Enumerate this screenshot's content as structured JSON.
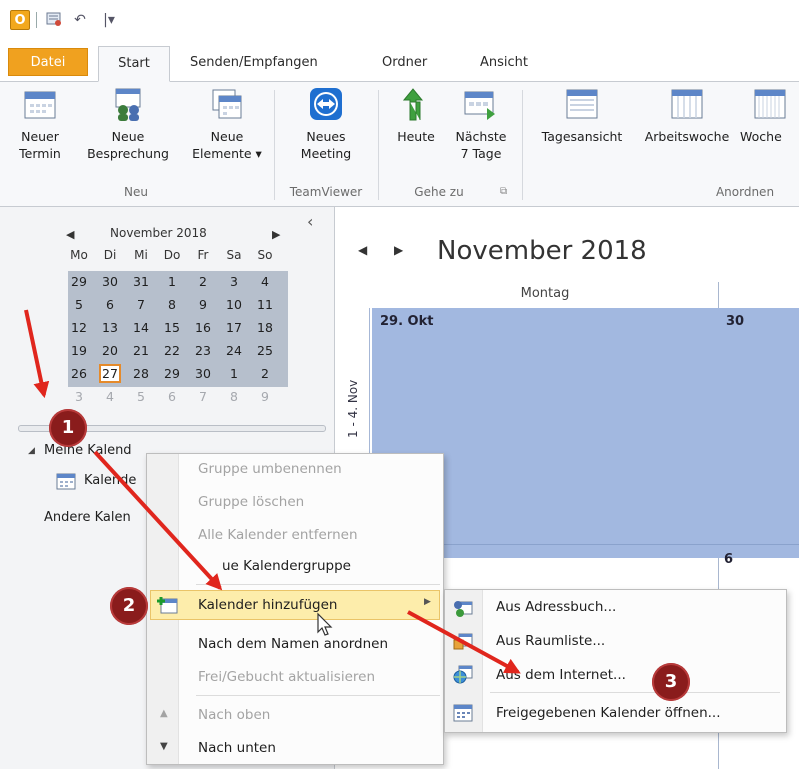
{
  "qat": {
    "undo_glyph": "↶",
    "dropdown_glyph": "|▾"
  },
  "tabs": {
    "file": "Datei",
    "start": "Start",
    "send_receive": "Senden/Empfangen",
    "folder": "Ordner",
    "view": "Ansicht"
  },
  "ribbon": {
    "new_appointment": [
      "Neuer",
      "Termin"
    ],
    "new_meeting": [
      "Neue",
      "Besprechung"
    ],
    "new_items": [
      "Neue",
      "Elemente ▾"
    ],
    "group_new": "Neu",
    "teamviewer_meeting": [
      "Neues",
      "Meeting"
    ],
    "group_teamviewer": "TeamViewer",
    "today": "Heute",
    "next7": [
      "Nächste",
      "7 Tage"
    ],
    "group_goto": "Gehe zu",
    "day_view": "Tagesansicht",
    "work_week": "Arbeitswoche",
    "week": "Woche",
    "group_arrange": "Anordnen"
  },
  "mini_calendar": {
    "month_label": "November 2018",
    "weekdays": [
      "Mo",
      "Di",
      "Mi",
      "Do",
      "Fr",
      "Sa",
      "So"
    ],
    "rows": [
      [
        "29",
        "30",
        "31",
        "1",
        "2",
        "3",
        "4"
      ],
      [
        "5",
        "6",
        "7",
        "8",
        "9",
        "10",
        "11"
      ],
      [
        "12",
        "13",
        "14",
        "15",
        "16",
        "17",
        "18"
      ],
      [
        "19",
        "20",
        "21",
        "22",
        "23",
        "24",
        "25"
      ],
      [
        "26",
        "27",
        "28",
        "29",
        "30",
        "1",
        "2"
      ],
      [
        "3",
        "4",
        "5",
        "6",
        "7",
        "8",
        "9"
      ]
    ],
    "today": "27"
  },
  "nav": {
    "collapse_glyph": "‹",
    "my_calendars": "Meine Kalend",
    "calendar_item": "Kalende",
    "other_calendars": "Andere Kalen"
  },
  "calendar": {
    "title": "November 2018",
    "column_header": "Montag",
    "cell_29oct": "29. Okt",
    "cell_30": "30",
    "cell_6": "6",
    "week_label": "1 - 4. Nov"
  },
  "context_menu": {
    "items": [
      {
        "label": "Gruppe umbenennen",
        "enabled": false
      },
      {
        "label": "Gruppe löschen",
        "enabled": false
      },
      {
        "label": "Alle Kalender entfernen",
        "enabled": false
      },
      {
        "label": "ue Kalendergruppe",
        "enabled": true
      },
      {
        "label": "Kalender hinzufügen",
        "enabled": true
      },
      {
        "label": "Nach dem Namen anordnen",
        "enabled": true
      },
      {
        "label": "Frei/Gebucht aktualisieren",
        "enabled": false
      },
      {
        "label": "Nach oben",
        "enabled": false
      },
      {
        "label": "Nach unten",
        "enabled": true
      }
    ]
  },
  "submenu": {
    "items": [
      {
        "label": "Aus Adressbuch..."
      },
      {
        "label": "Aus Raumliste..."
      },
      {
        "label": "Aus dem Internet..."
      },
      {
        "label": "Freigegebenen Kalender öffnen..."
      }
    ]
  },
  "badges": [
    "1",
    "2",
    "3"
  ],
  "colors": {
    "accent_orange": "#f0a11f",
    "calendar_fill": "#a2b8e0",
    "highlight": "#fdedab",
    "annotation_red": "#e0261d",
    "badge": "#8a1c1c"
  }
}
